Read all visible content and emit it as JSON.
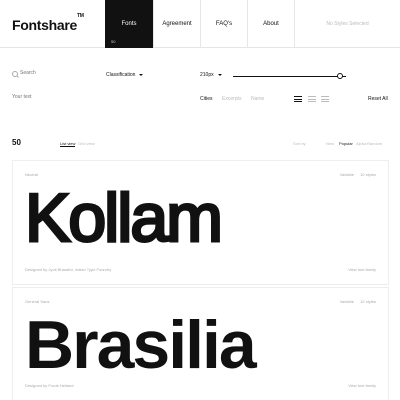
{
  "header": {
    "logo": "Fontshare",
    "logo_tm": "TM",
    "nav": {
      "fonts": "Fonts",
      "fonts_count": "50",
      "agreement": "Agreement",
      "faq": "FAQ's",
      "about": "About"
    },
    "styles_selected": "No Styles Selected"
  },
  "filters": {
    "search_placeholder": "Search",
    "classification": "Classification",
    "size": "210px",
    "size_level": 0.95,
    "text_placeholder": "Your text",
    "sample_options": [
      "Cities",
      "Excerpts",
      "Name"
    ],
    "reset": "Reset All"
  },
  "results": {
    "count": "50",
    "view_list": "List view",
    "view_grid": "Grid view",
    "sort_label": "Sort by",
    "sort_options": [
      "New",
      "Popular",
      "Alpha",
      "Random"
    ]
  },
  "cards": [
    {
      "classification": "Neutral",
      "variable": "Variable",
      "styles": "10 styles",
      "sample": "Kollam",
      "designer": "Designed by Jyoti Bharathi, Indian Type Foundry",
      "link": "View font family"
    },
    {
      "classification": "General Sans",
      "variable": "Variable",
      "styles": "12 styles",
      "sample": "Brasilia",
      "designer": "Designed by Frode Helland",
      "link": "View font family"
    }
  ],
  "colors": {
    "text": "#111111",
    "muted": "#aaaaaa",
    "active_nav_bg": "#111111"
  }
}
